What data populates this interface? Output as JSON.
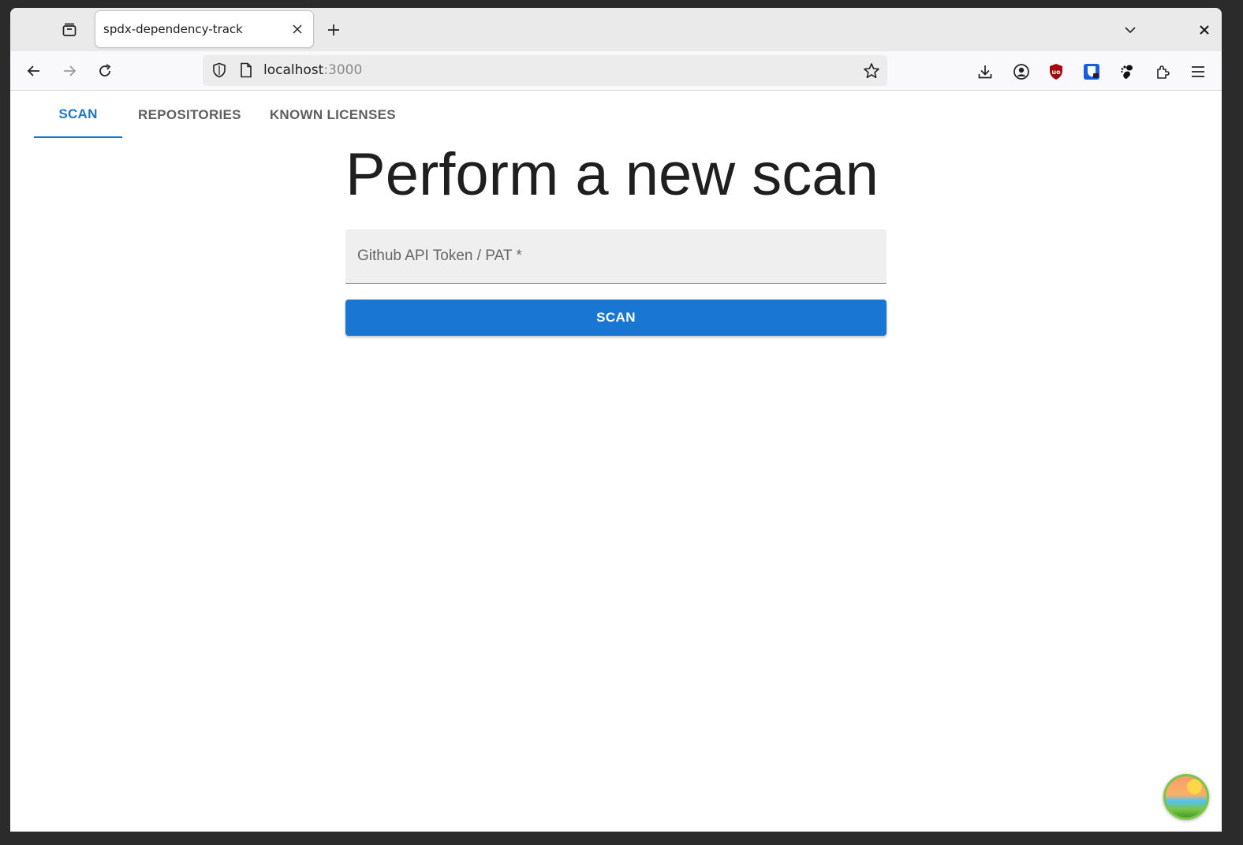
{
  "browser": {
    "tab_title": "spdx-dependency-track",
    "url_host": "localhost",
    "url_port": ":3000"
  },
  "app": {
    "tabs": [
      {
        "label": "SCAN"
      },
      {
        "label": "REPOSITORIES"
      },
      {
        "label": "KNOWN LICENSES"
      }
    ],
    "title": "Perform a new scan",
    "token_placeholder": "Github API Token / PAT *",
    "scan_label": "SCAN"
  },
  "colors": {
    "accent": "#1976d2"
  }
}
